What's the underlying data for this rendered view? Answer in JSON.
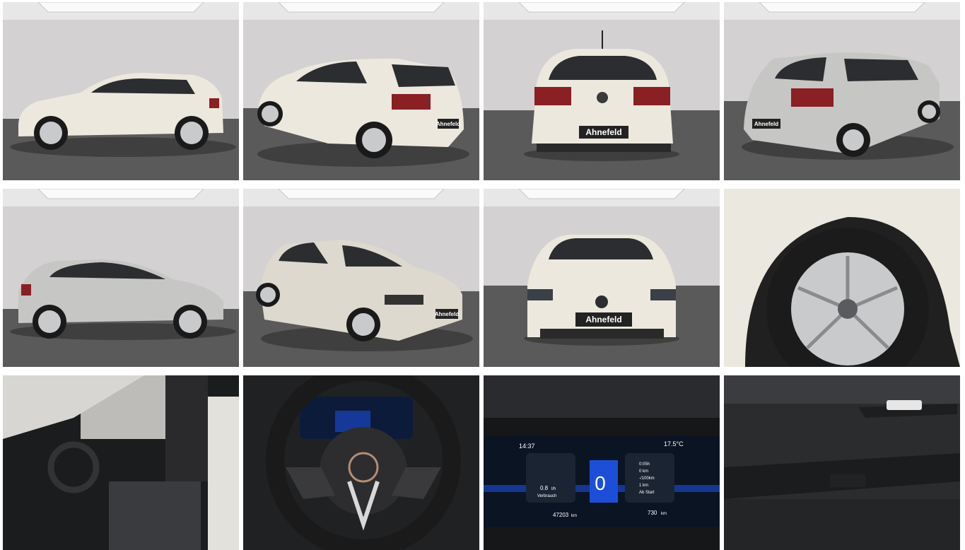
{
  "gallery": {
    "dealer_plate": "Ahnefeld",
    "plate_tile_2": "Ahnefeld",
    "plate_tile_6": "Ahnefeld",
    "plate_tile_1": "Ahnefeld",
    "plate_tile_5": "Ahnefeld"
  },
  "dashboard": {
    "time": "14:37",
    "temperature": "17.5°C",
    "speed": "0",
    "consumption_value": "0.8",
    "consumption_unit": "l/h",
    "consumption_label": "Verbrauch",
    "trip_time": "0:05h",
    "trip_distance_avg": "0 km",
    "trip_consumption": "-/100km",
    "trip_km": "1 km",
    "trip_label": "Ab Start",
    "odometer": "47203",
    "odometer_unit": "km",
    "range": "730",
    "range_unit": "km"
  },
  "colors": {
    "car_body": "#ece8dd",
    "studio_wall": "#d4d2d3",
    "studio_floor": "#585858",
    "taillight": "#8a1f24",
    "interior": "#1c1d1f"
  },
  "icons": [
    "vw-logo-icon",
    "speedometer-icon",
    "fuel-icon",
    "odometer-icon"
  ]
}
